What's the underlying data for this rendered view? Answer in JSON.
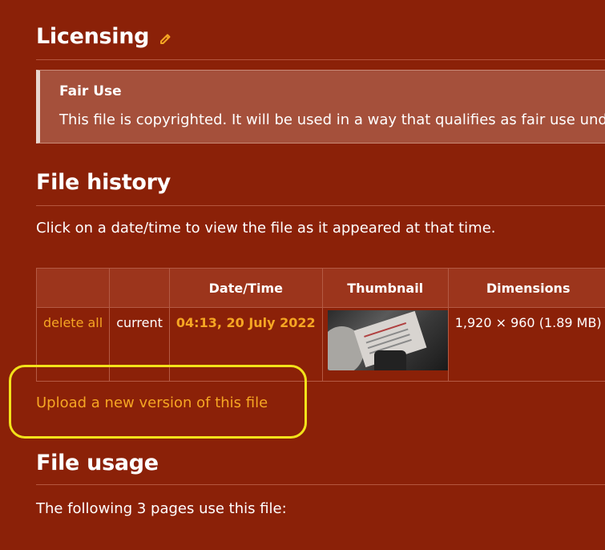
{
  "licensing": {
    "heading": "Licensing",
    "notice_title": "Fair Use",
    "notice_text": "This file is copyrighted. It will be used in a way that qualifies as fair use under US copyright law."
  },
  "file_history": {
    "heading": "File history",
    "description": "Click on a date/time to view the file as it appeared at that time.",
    "columns": [
      "",
      "",
      "Date/Time",
      "Thumbnail",
      "Dimensions",
      ""
    ],
    "rows": [
      {
        "action": "delete all",
        "status": "current",
        "datetime": "04:13, 20 July 2022",
        "thumbnail_alt": "thumbnail",
        "dimensions": "1,920 × 960 (1.89 MB)"
      }
    ],
    "upload_link": "Upload a new version of this file"
  },
  "file_usage": {
    "heading": "File usage",
    "description": "The following 3 pages use this file:"
  },
  "colors": {
    "background": "#8b2108",
    "link": "#f6a623",
    "highlight": "#f2e21a"
  },
  "icons": [
    "pencil-icon"
  ]
}
